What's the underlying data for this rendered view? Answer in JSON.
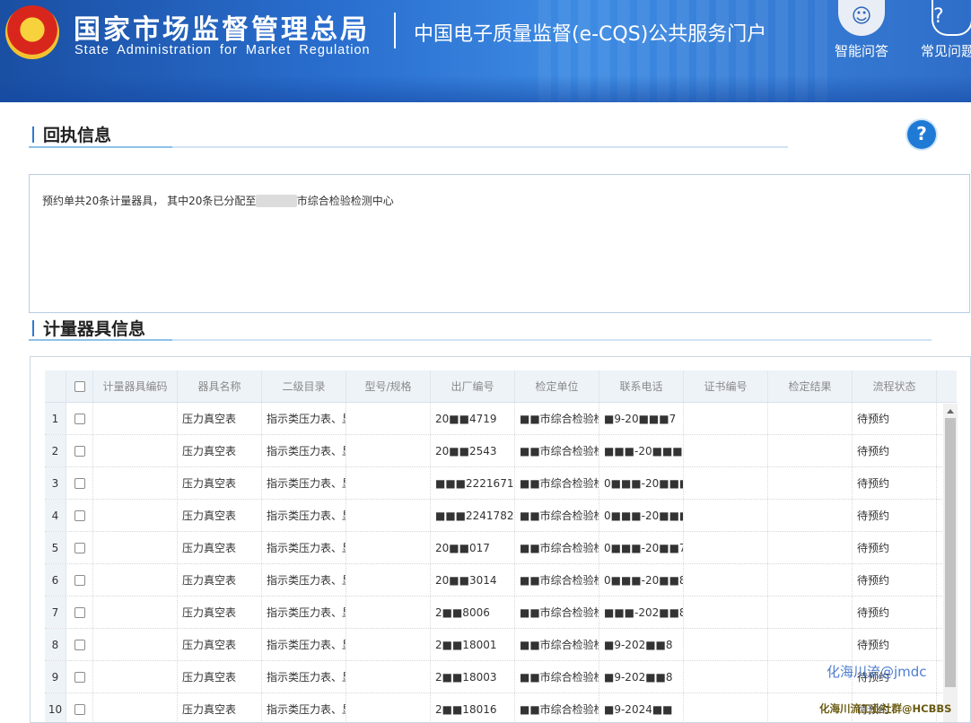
{
  "header": {
    "org_cn": "国家市场监督管理总局",
    "org_en": "State Administration for Market Regulation",
    "portal": "中国电子质量监督(e-CQS)公共服务门户",
    "emblem_icon": "national-emblem-icon",
    "buttons": [
      {
        "label": "智能问答",
        "icon": "robot-assistant-icon"
      },
      {
        "label": "常见问题",
        "icon": "faq-icon"
      }
    ]
  },
  "receipt": {
    "title": "回执信息",
    "text_prefix": "预约单共20条计量器具，  其中20条已分配至",
    "text_masked": "■■■■",
    "text_suffix": "市综合检验检测中心"
  },
  "instruments": {
    "title": "计量器具信息",
    "columns": [
      "计量器具编码",
      "器具名称",
      "二级目录",
      "型号/规格",
      "出厂编号",
      "检定单位",
      "联系电话",
      "证书编号",
      "检定结果",
      "流程状态"
    ],
    "rows": [
      {
        "idx": "1",
        "code": "",
        "name": "压力真空表",
        "cat": "指示类压力表、显",
        "model": "",
        "serial": "20■■4719",
        "unit": "■■市综合检验检",
        "phone": "■9-20■■■7",
        "cert": "",
        "result": "",
        "status": "待预约"
      },
      {
        "idx": "2",
        "code": "",
        "name": "压力真空表",
        "cat": "指示类压力表、显",
        "model": "",
        "serial": "20■■2543",
        "unit": "■■市综合检验检",
        "phone": "■■■-20■■■",
        "cert": "",
        "result": "",
        "status": "待预约"
      },
      {
        "idx": "3",
        "code": "",
        "name": "压力真空表",
        "cat": "指示类压力表、显",
        "model": "",
        "serial": "■■■22216712",
        "unit": "■■市综合检验检",
        "phone": "0■■■-20■■■",
        "cert": "",
        "result": "",
        "status": "待预约"
      },
      {
        "idx": "4",
        "code": "",
        "name": "压力真空表",
        "cat": "指示类压力表、显",
        "model": "",
        "serial": "■■■2241782",
        "unit": "■■市综合检验检",
        "phone": "0■■■-20■■■",
        "cert": "",
        "result": "",
        "status": "待预约"
      },
      {
        "idx": "5",
        "code": "",
        "name": "压力真空表",
        "cat": "指示类压力表、显",
        "model": "",
        "serial": "20■■017",
        "unit": "■■市综合检验检",
        "phone": "0■■■-20■■78",
        "cert": "",
        "result": "",
        "status": "待预约"
      },
      {
        "idx": "6",
        "code": "",
        "name": "压力真空表",
        "cat": "指示类压力表、显",
        "model": "",
        "serial": "20■■3014",
        "unit": "■■市综合检验检",
        "phone": "0■■■-20■■8",
        "cert": "",
        "result": "",
        "status": "待预约"
      },
      {
        "idx": "7",
        "code": "",
        "name": "压力真空表",
        "cat": "指示类压力表、显",
        "model": "",
        "serial": "2■■8006",
        "unit": "■■市综合检验检",
        "phone": "■■■-202■■8",
        "cert": "",
        "result": "",
        "status": "待预约"
      },
      {
        "idx": "8",
        "code": "",
        "name": "压力真空表",
        "cat": "指示类压力表、显",
        "model": "",
        "serial": "2■■18001",
        "unit": "■■市综合检验检",
        "phone": "■9-202■■8",
        "cert": "",
        "result": "",
        "status": "待预约"
      },
      {
        "idx": "9",
        "code": "",
        "name": "压力真空表",
        "cat": "指示类压力表、显",
        "model": "",
        "serial": "2■■18003",
        "unit": "■■市综合检验检",
        "phone": "■9-202■■8",
        "cert": "",
        "result": "",
        "status": "待预约"
      },
      {
        "idx": "10",
        "code": "",
        "name": "压力真空表",
        "cat": "指示类压力表、显",
        "model": "",
        "serial": "2■■18016",
        "unit": "■■市综合检验检",
        "phone": "■9-2024■■",
        "cert": "",
        "result": "",
        "status": "待预约"
      }
    ]
  },
  "watermarks": [
    "化海川流@jmdc",
    "化海川流工业社群@HCBBS"
  ],
  "colors": {
    "header_blue": "#2a6fcf",
    "accent": "#1f7ad6",
    "table_head": "#eef3f8"
  }
}
